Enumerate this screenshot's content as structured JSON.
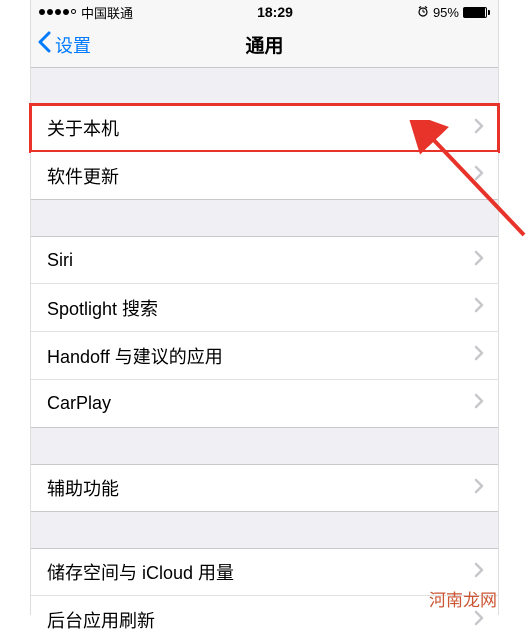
{
  "status": {
    "carrier": "中国联通",
    "time": "18:29",
    "battery": "95%"
  },
  "nav": {
    "back_label": "设置",
    "title": "通用"
  },
  "groups": [
    {
      "items": [
        {
          "label": "关于本机",
          "highlighted": true
        },
        {
          "label": "软件更新"
        }
      ]
    },
    {
      "items": [
        {
          "label": "Siri"
        },
        {
          "label": "Spotlight 搜索"
        },
        {
          "label": "Handoff 与建议的应用"
        },
        {
          "label": "CarPlay"
        }
      ]
    },
    {
      "items": [
        {
          "label": "辅助功能"
        }
      ]
    },
    {
      "items": [
        {
          "label": "储存空间与 iCloud 用量"
        },
        {
          "label": "后台应用刷新"
        }
      ]
    }
  ],
  "watermark": "河南龙网"
}
